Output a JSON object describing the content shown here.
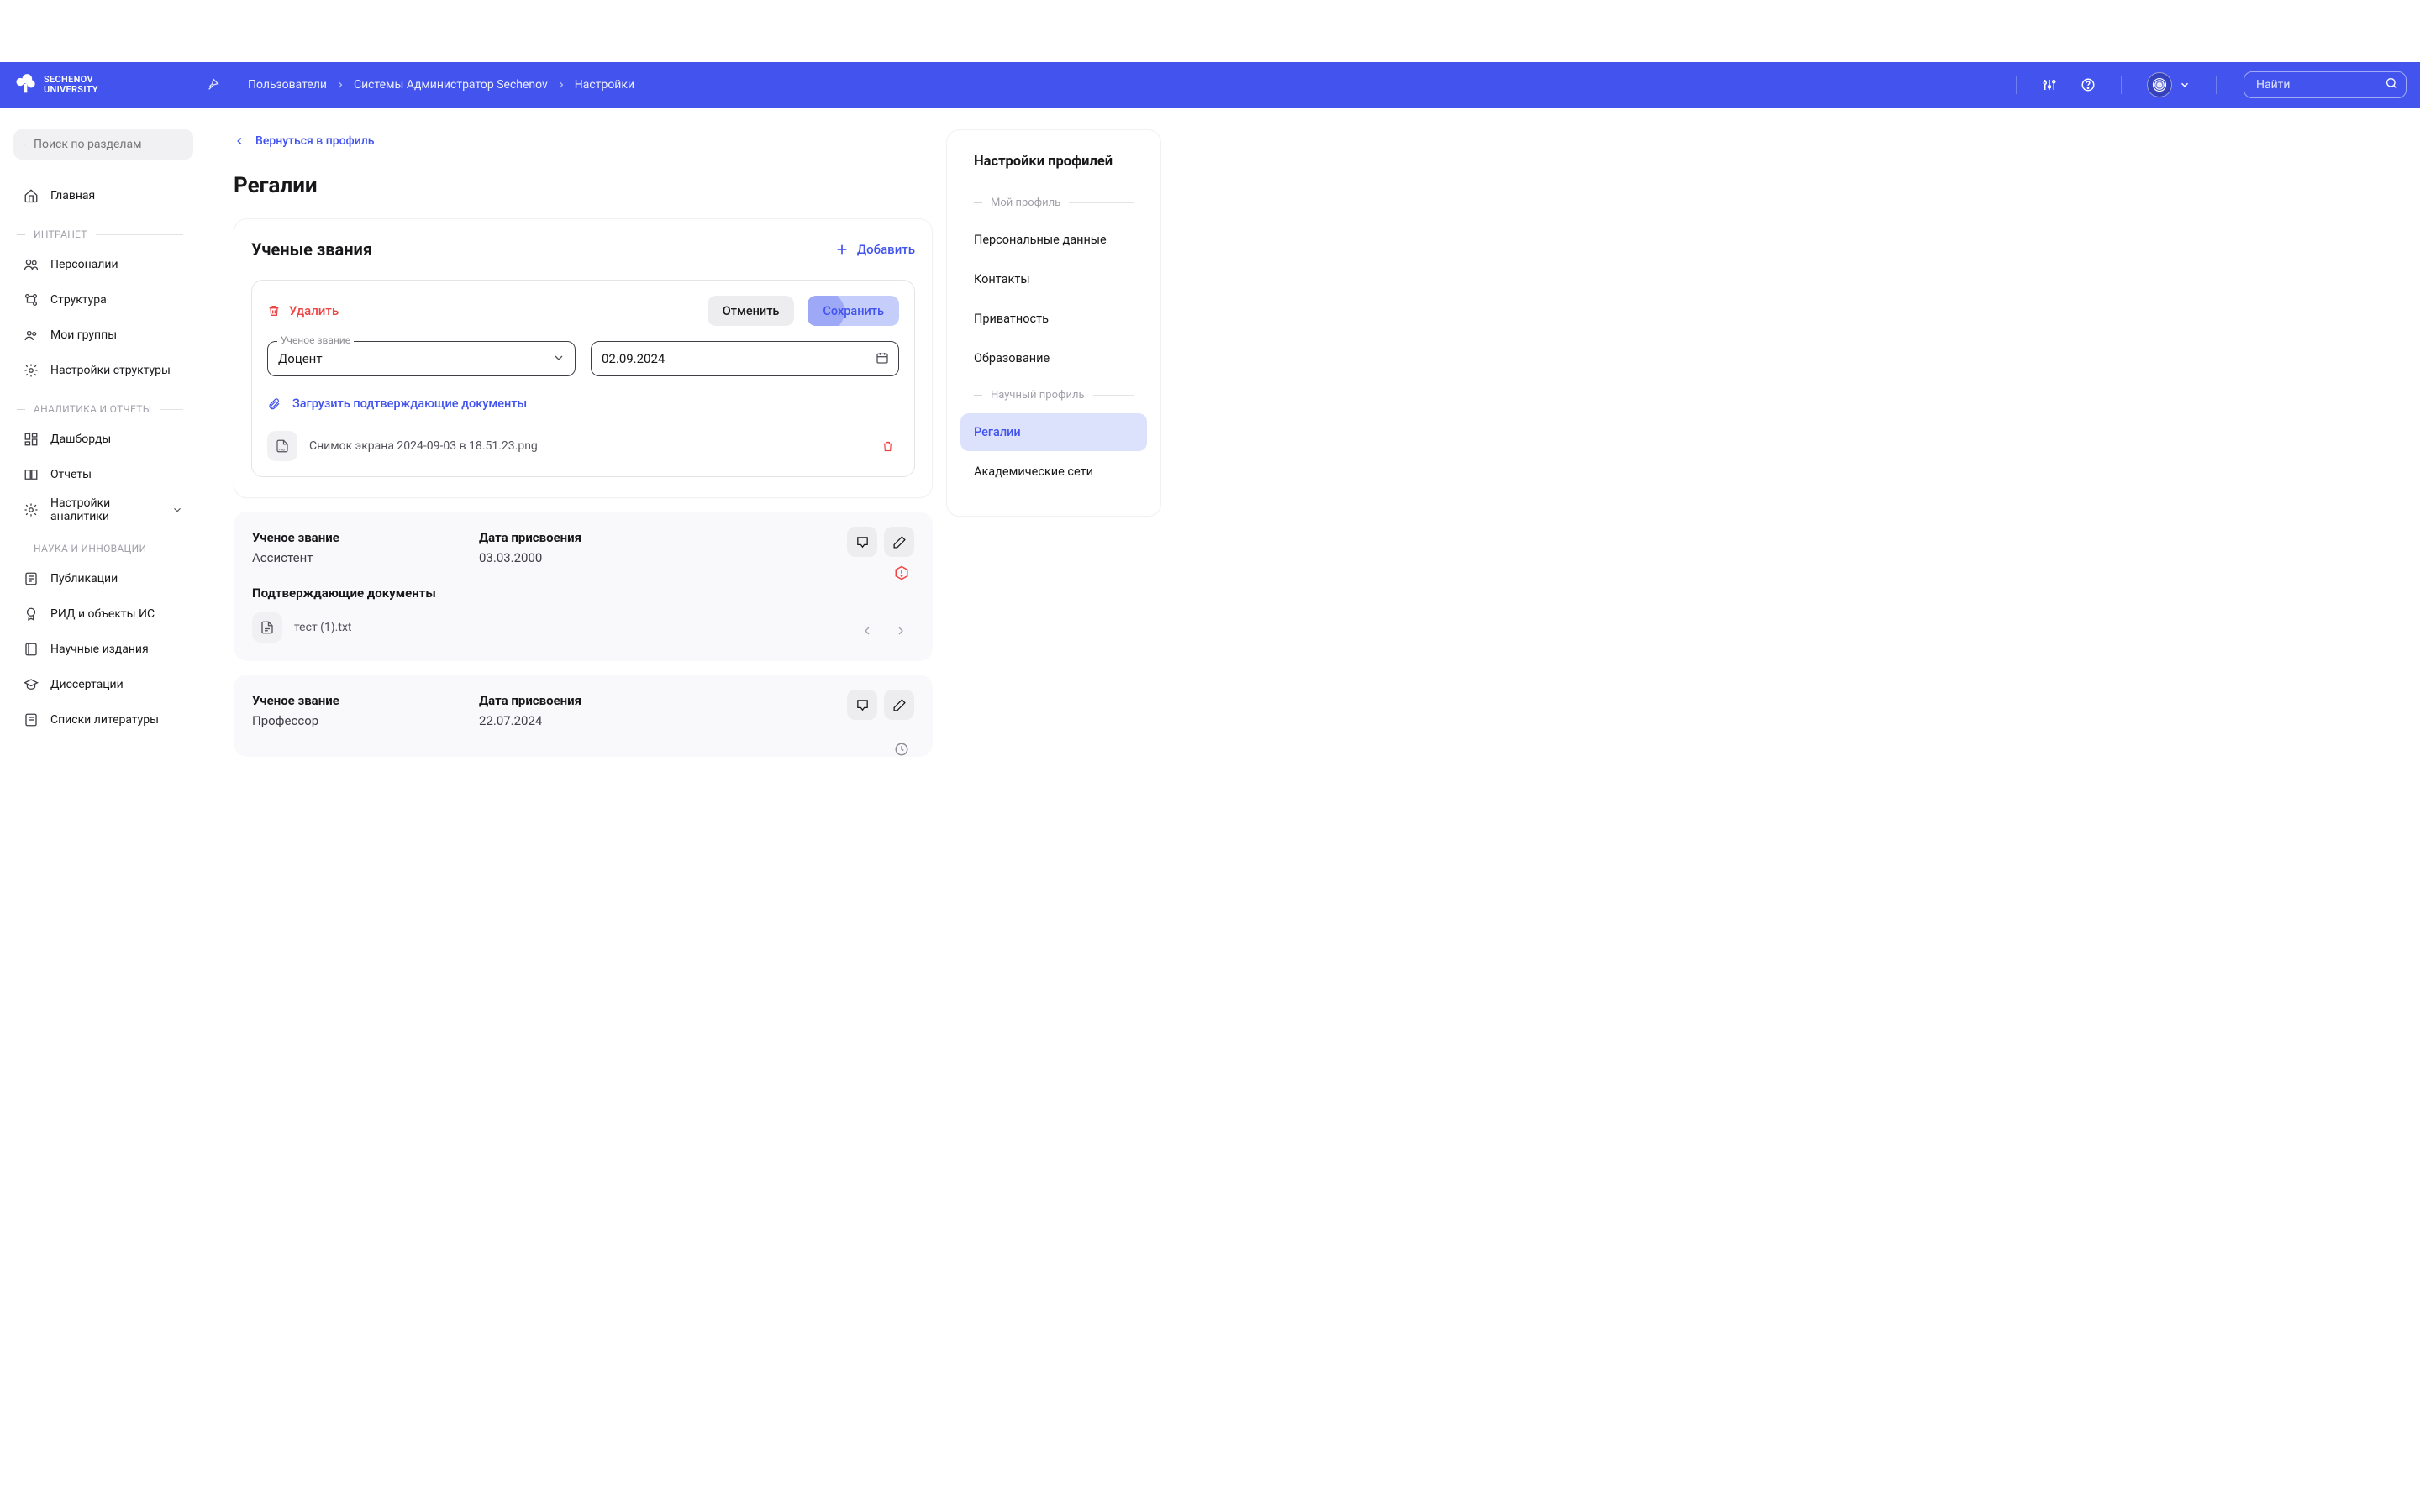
{
  "brand": {
    "line1": "SECHENOV",
    "line2": "UNIVERSITY"
  },
  "breadcrumbs": {
    "a": "Пользователи",
    "b": "Системы Администратор Sechenov",
    "c": "Настройки"
  },
  "search": {
    "global_placeholder": "Найти",
    "sidebar_placeholder": "Поиск по разделам"
  },
  "sidebar": {
    "home": "Главная",
    "sec1": "ИНТРАНЕТ",
    "s1_1": "Персоналии",
    "s1_2": "Структура",
    "s1_3": "Мои группы",
    "s1_4": "Настройки структуры",
    "sec2": "АНАЛИТИКА И ОТЧЕТЫ",
    "s2_1": "Дашборды",
    "s2_2": "Отчеты",
    "s2_3": "Настройки аналитики",
    "sec3": "НАУКА И ИННОВАЦИИ",
    "s3_1": "Публикации",
    "s3_2": "РИД и объекты ИС",
    "s3_3": "Научные издания",
    "s3_4": "Диссертации",
    "s3_5": "Списки литературы"
  },
  "back_label": "Вернуться в профиль",
  "page_title": "Регалии",
  "section_title": "Ученые звания",
  "add_label": "Добавить",
  "edit": {
    "delete": "Удалить",
    "cancel": "Отменить",
    "save": "Сохранить",
    "rank_label": "Ученое звание",
    "rank_value": "Доцент",
    "date_value": "02.09.2024",
    "upload": "Загрузить подтверждающие документы",
    "file": "Снимок экрана 2024-09-03 в 18.51.23.png"
  },
  "records": [
    {
      "rank_label": "Ученое звание",
      "rank_value": "Ассистент",
      "date_label": "Дата присвоения",
      "date_value": "03.03.2000",
      "docs_label": "Подтверждающие документы",
      "doc_file": "тест (1).txt"
    },
    {
      "rank_label": "Ученое звание",
      "rank_value": "Профессор",
      "date_label": "Дата присвоения",
      "date_value": "22.07.2024"
    }
  ],
  "rail": {
    "title": "Настройки профилей",
    "sec1": "Мой профиль",
    "i1": "Персональные данные",
    "i2": "Контакты",
    "i3": "Приватность",
    "i4": "Образование",
    "sec2": "Научный профиль",
    "i5": "Регалии",
    "i6": "Академические сети"
  }
}
